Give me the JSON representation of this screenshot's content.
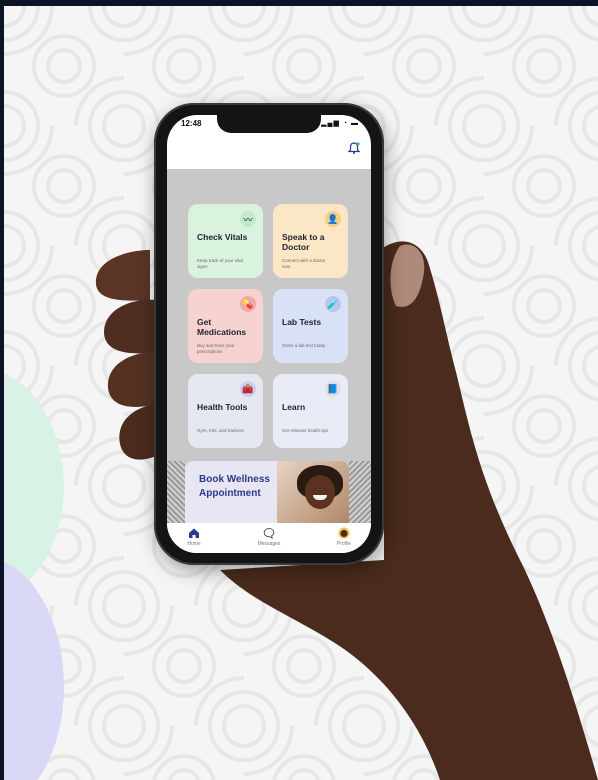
{
  "status": {
    "time": "12:48",
    "icons": "▂▄▆ ◔ ▬"
  },
  "tiles": [
    {
      "title": "Check Vitals",
      "subtitle": "Keep track of your vital signs",
      "bg": "#d9f3df",
      "icon_bg": "#bfe9c9",
      "icon": "heartbeat-icon",
      "glyph": "〰"
    },
    {
      "title": "Speak to a Doctor",
      "subtitle": "Connect with a doctor now",
      "bg": "#fbe7c6",
      "icon_bg": "#f6cf86",
      "icon": "doctor-icon",
      "glyph": "👤"
    },
    {
      "title": "Get Medications",
      "subtitle": "Buy and track your prescriptions",
      "bg": "#f6d3d0",
      "icon_bg": "#efaaa4",
      "icon": "pills-icon",
      "glyph": "💊"
    },
    {
      "title": "Lab Tests",
      "subtitle": "Order a lab test today",
      "bg": "#d9e1f6",
      "icon_bg": "#b8c6f0",
      "icon": "lab-icon",
      "glyph": "🧪"
    },
    {
      "title": "Health Tools",
      "subtitle": "Gym, Kits, and trackers",
      "bg": "#e6e8ef",
      "icon_bg": "#c9cef0",
      "icon": "toolbox-icon",
      "glyph": "🧰"
    },
    {
      "title": "Learn",
      "subtitle": "Get relevant health tips",
      "bg": "#e9ecf6",
      "icon_bg": "#dcdfea",
      "icon": "book-icon",
      "glyph": "📘"
    }
  ],
  "banner": {
    "text": "Book Wellness Appointment"
  },
  "tabs": [
    {
      "label": "Home",
      "icon": "home-icon"
    },
    {
      "label": "Messages",
      "icon": "chat-icon"
    },
    {
      "label": "Profile",
      "icon": "profile-icon"
    }
  ],
  "colors": {
    "accent": "#2a3a8a",
    "background": "#f4f5f4"
  }
}
